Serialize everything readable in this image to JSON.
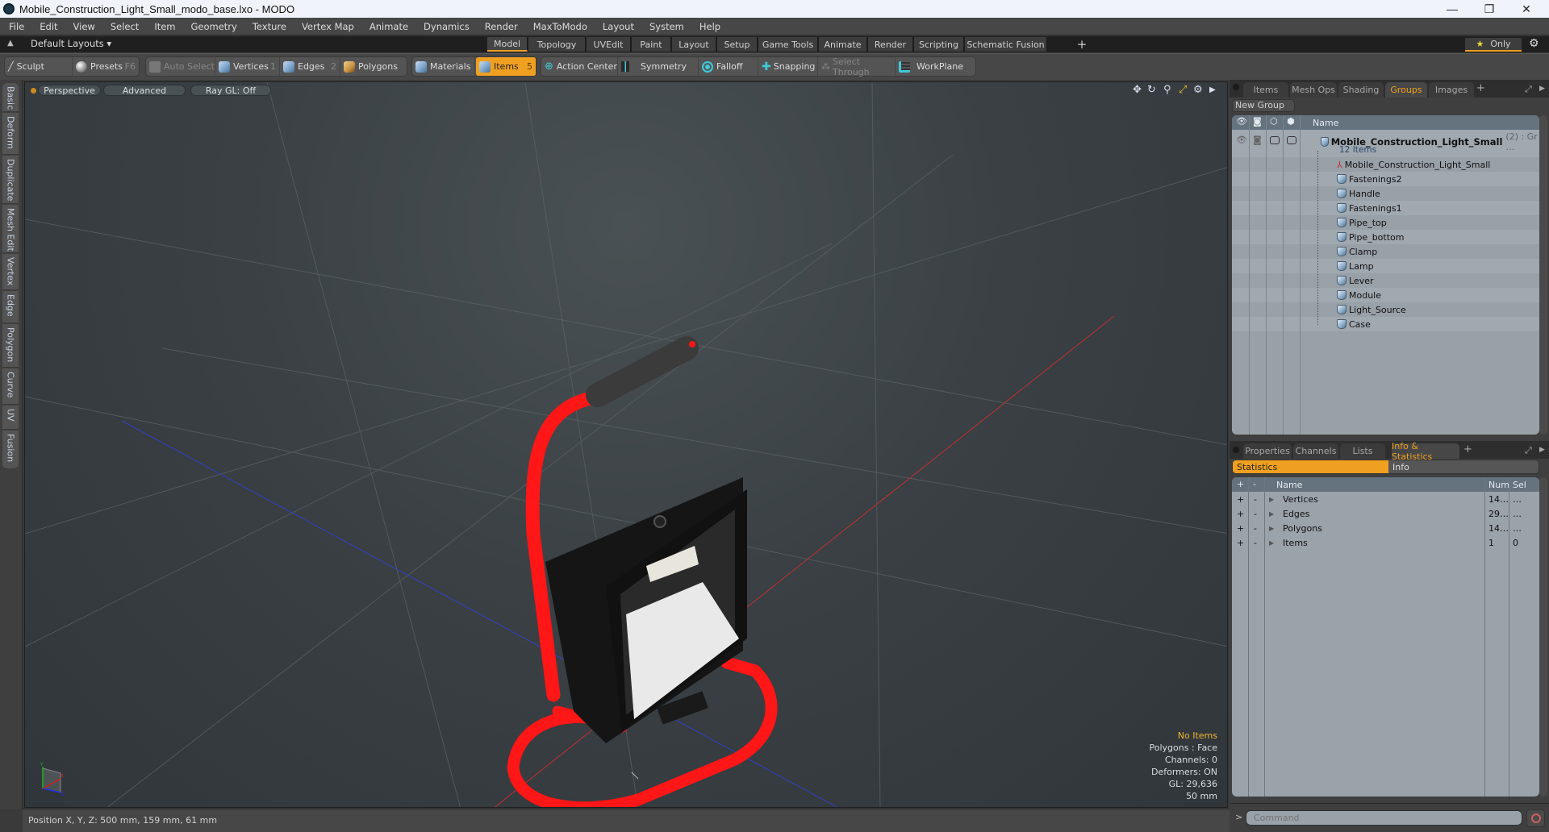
{
  "window": {
    "title": "Mobile_Construction_Light_Small_modo_base.lxo - MODO",
    "minimize": "—",
    "maximize": "❐",
    "close": "✕"
  },
  "menu": [
    "File",
    "Edit",
    "View",
    "Select",
    "Item",
    "Geometry",
    "Texture",
    "Vertex Map",
    "Animate",
    "Dynamics",
    "Render",
    "MaxToModo",
    "Layout",
    "System",
    "Help"
  ],
  "layoutbar": {
    "layout_selector": "Default Layouts ▾",
    "tabs": [
      "Model",
      "Topology",
      "UVEdit",
      "Paint",
      "Layout",
      "Setup",
      "Game Tools",
      "Animate",
      "Render",
      "Scripting",
      "Schematic Fusion"
    ],
    "active_tab": "Model",
    "add": "+",
    "only_label": "Only",
    "star": "★"
  },
  "toolbar": {
    "sculpt": "Sculpt",
    "presets": "Presets",
    "presets_key": "F6",
    "auto_select": "Auto Select",
    "vertices": "Vertices",
    "vertices_key": "1",
    "edges": "Edges",
    "edges_key": "2",
    "polygons": "Polygons",
    "materials": "Materials",
    "items": "Items",
    "items_key": "5",
    "action_center": "Action Center",
    "symmetry": "Symmetry",
    "falloff": "Falloff",
    "snapping": "Snapping",
    "select_through": "Select Through",
    "workplane": "WorkPlane"
  },
  "left_tabs": [
    "Basic",
    "Deform",
    "Duplicate",
    "Mesh Edit",
    "Vertex",
    "Edge",
    "Polygon",
    "Curve",
    "UV",
    "Fusion"
  ],
  "viewport": {
    "view_mode": "Perspective",
    "shading": "Advanced",
    "raygl": "Ray GL: Off",
    "hud": {
      "selection": "No Items",
      "polygons": "Polygons : Face",
      "channels": "Channels: 0",
      "deformers": "Deformers: ON",
      "gl": "GL: 29,636",
      "grid": "50 mm"
    },
    "model_colors": {
      "frame": "#ff1a1a",
      "handle": "#3a3a3a",
      "housing": "#151515",
      "glass": "#e8e8e8"
    }
  },
  "status": {
    "position": "Position X, Y, Z:   500 mm, 159 mm, 61 mm"
  },
  "groups_panel": {
    "tabs": [
      "Items",
      "Mesh Ops",
      "Shading",
      "Groups",
      "Images"
    ],
    "active_tab": "Groups",
    "new_group": "New Group",
    "column_name": "Name",
    "group": {
      "name": "Mobile_Construction_Light_Small",
      "suffix": "(2) : Gr …",
      "count": "12 Items"
    },
    "items": [
      "Mobile_Construction_Light_Small",
      "Fastenings2",
      "Handle",
      "Fastenings1",
      "Pipe_top",
      "Pipe_bottom",
      "Clamp",
      "Lamp",
      "Lever",
      "Module",
      "Light_Source",
      "Case"
    ]
  },
  "stats_panel": {
    "tabs": [
      "Properties",
      "Channels",
      "Lists",
      "Info & Statistics"
    ],
    "active_tab": "Info & Statistics",
    "toggle": [
      "Statistics",
      "Info"
    ],
    "active_toggle": "Statistics",
    "columns": {
      "plus": "+",
      "minus": "-",
      "name": "Name",
      "num": "Num",
      "sel": "Sel"
    },
    "rows": [
      {
        "name": "Vertices",
        "num": "14…",
        "sel": "…"
      },
      {
        "name": "Edges",
        "num": "29…",
        "sel": "…"
      },
      {
        "name": "Polygons",
        "num": "14…",
        "sel": "…"
      },
      {
        "name": "Items",
        "num": "1",
        "sel": "0"
      }
    ]
  },
  "command": {
    "prompt": ">",
    "placeholder": "Command"
  },
  "accent": "#f0a020"
}
